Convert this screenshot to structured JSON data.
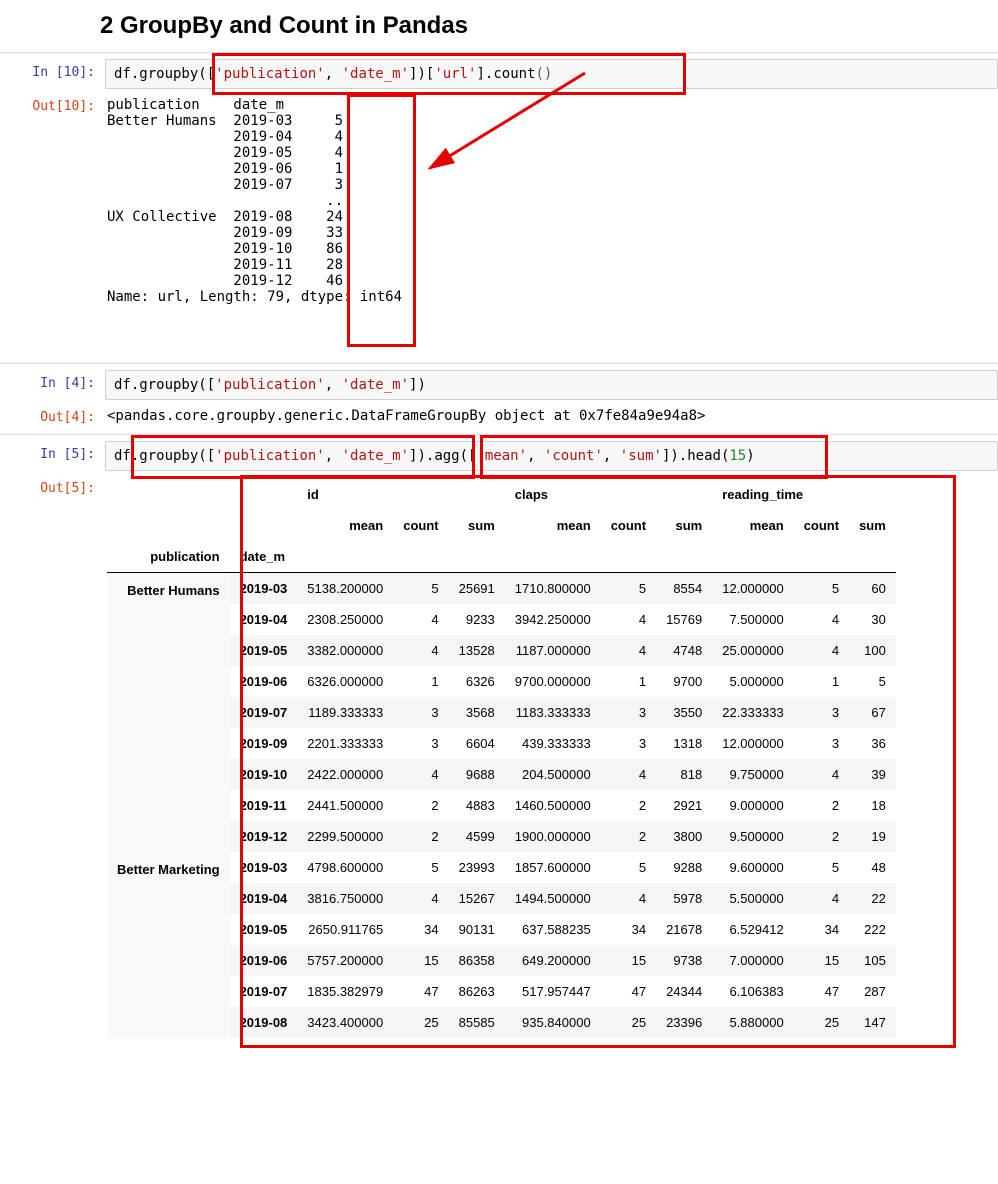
{
  "heading": "2  GroupBy and Count in Pandas",
  "cells": {
    "c10": {
      "prompt_in": "In [10]:",
      "prompt_out": "Out[10]:",
      "code_plain": "df.groupby(['publication', 'date_m'])['url'].count()",
      "out_lines": [
        "publication    date_m ",
        "Better Humans  2019-03     5",
        "               2019-04     4",
        "               2019-05     4",
        "               2019-06     1",
        "               2019-07     3",
        "                          ..",
        "UX Collective  2019-08    24",
        "               2019-09    33",
        "               2019-10    86",
        "               2019-11    28",
        "               2019-12    46",
        "Name: url, Length: 79, dtype: int64"
      ]
    },
    "c4": {
      "prompt_in": "In [4]:",
      "prompt_out": "Out[4]:",
      "code_plain": "df.groupby(['publication', 'date_m'])",
      "out_text": "<pandas.core.groupby.generic.DataFrameGroupBy object at 0x7fe84a9e94a8>"
    },
    "c5": {
      "prompt_in": "In [5]:",
      "prompt_out": "Out[5]:",
      "code_plain": "df.groupby(['publication', 'date_m']).agg(['mean', 'count', 'sum']).head(15)"
    }
  },
  "df": {
    "index_names": [
      "publication",
      "date_m"
    ],
    "top_cols": [
      "id",
      "claps",
      "reading_time"
    ],
    "sub_cols": [
      "mean",
      "count",
      "sum"
    ],
    "groups": [
      {
        "publication": "Better Humans",
        "rows": [
          {
            "date": "2019-03",
            "id_mean": "5138.200000",
            "id_count": "5",
            "id_sum": "25691",
            "cl_mean": "1710.800000",
            "cl_count": "5",
            "cl_sum": "8554",
            "rt_mean": "12.000000",
            "rt_count": "5",
            "rt_sum": "60"
          },
          {
            "date": "2019-04",
            "id_mean": "2308.250000",
            "id_count": "4",
            "id_sum": "9233",
            "cl_mean": "3942.250000",
            "cl_count": "4",
            "cl_sum": "15769",
            "rt_mean": "7.500000",
            "rt_count": "4",
            "rt_sum": "30"
          },
          {
            "date": "2019-05",
            "id_mean": "3382.000000",
            "id_count": "4",
            "id_sum": "13528",
            "cl_mean": "1187.000000",
            "cl_count": "4",
            "cl_sum": "4748",
            "rt_mean": "25.000000",
            "rt_count": "4",
            "rt_sum": "100"
          },
          {
            "date": "2019-06",
            "id_mean": "6326.000000",
            "id_count": "1",
            "id_sum": "6326",
            "cl_mean": "9700.000000",
            "cl_count": "1",
            "cl_sum": "9700",
            "rt_mean": "5.000000",
            "rt_count": "1",
            "rt_sum": "5"
          },
          {
            "date": "2019-07",
            "id_mean": "1189.333333",
            "id_count": "3",
            "id_sum": "3568",
            "cl_mean": "1183.333333",
            "cl_count": "3",
            "cl_sum": "3550",
            "rt_mean": "22.333333",
            "rt_count": "3",
            "rt_sum": "67"
          },
          {
            "date": "2019-09",
            "id_mean": "2201.333333",
            "id_count": "3",
            "id_sum": "6604",
            "cl_mean": "439.333333",
            "cl_count": "3",
            "cl_sum": "1318",
            "rt_mean": "12.000000",
            "rt_count": "3",
            "rt_sum": "36"
          },
          {
            "date": "2019-10",
            "id_mean": "2422.000000",
            "id_count": "4",
            "id_sum": "9688",
            "cl_mean": "204.500000",
            "cl_count": "4",
            "cl_sum": "818",
            "rt_mean": "9.750000",
            "rt_count": "4",
            "rt_sum": "39"
          },
          {
            "date": "2019-11",
            "id_mean": "2441.500000",
            "id_count": "2",
            "id_sum": "4883",
            "cl_mean": "1460.500000",
            "cl_count": "2",
            "cl_sum": "2921",
            "rt_mean": "9.000000",
            "rt_count": "2",
            "rt_sum": "18"
          },
          {
            "date": "2019-12",
            "id_mean": "2299.500000",
            "id_count": "2",
            "id_sum": "4599",
            "cl_mean": "1900.000000",
            "cl_count": "2",
            "cl_sum": "3800",
            "rt_mean": "9.500000",
            "rt_count": "2",
            "rt_sum": "19"
          }
        ]
      },
      {
        "publication": "Better Marketing",
        "rows": [
          {
            "date": "2019-03",
            "id_mean": "4798.600000",
            "id_count": "5",
            "id_sum": "23993",
            "cl_mean": "1857.600000",
            "cl_count": "5",
            "cl_sum": "9288",
            "rt_mean": "9.600000",
            "rt_count": "5",
            "rt_sum": "48"
          },
          {
            "date": "2019-04",
            "id_mean": "3816.750000",
            "id_count": "4",
            "id_sum": "15267",
            "cl_mean": "1494.500000",
            "cl_count": "4",
            "cl_sum": "5978",
            "rt_mean": "5.500000",
            "rt_count": "4",
            "rt_sum": "22"
          },
          {
            "date": "2019-05",
            "id_mean": "2650.911765",
            "id_count": "34",
            "id_sum": "90131",
            "cl_mean": "637.588235",
            "cl_count": "34",
            "cl_sum": "21678",
            "rt_mean": "6.529412",
            "rt_count": "34",
            "rt_sum": "222"
          },
          {
            "date": "2019-06",
            "id_mean": "5757.200000",
            "id_count": "15",
            "id_sum": "86358",
            "cl_mean": "649.200000",
            "cl_count": "15",
            "cl_sum": "9738",
            "rt_mean": "7.000000",
            "rt_count": "15",
            "rt_sum": "105"
          },
          {
            "date": "2019-07",
            "id_mean": "1835.382979",
            "id_count": "47",
            "id_sum": "86263",
            "cl_mean": "517.957447",
            "cl_count": "47",
            "cl_sum": "24344",
            "rt_mean": "6.106383",
            "rt_count": "47",
            "rt_sum": "287"
          },
          {
            "date": "2019-08",
            "id_mean": "3423.400000",
            "id_count": "25",
            "id_sum": "85585",
            "cl_mean": "935.840000",
            "cl_count": "25",
            "cl_sum": "23396",
            "rt_mean": "5.880000",
            "rt_count": "25",
            "rt_sum": "147"
          }
        ]
      }
    ]
  }
}
